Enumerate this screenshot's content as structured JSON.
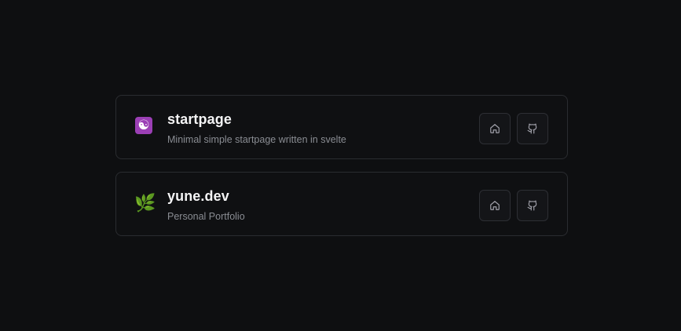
{
  "projects": [
    {
      "emoji": "☯",
      "title": "startpage",
      "description": "Minimal simple startpage written in svelte",
      "home_icon": "home-icon",
      "github_icon": "github-icon"
    },
    {
      "emoji": "🌿",
      "title": "yune.dev",
      "description": "Personal Portfolio",
      "home_icon": "home-icon",
      "github_icon": "github-icon"
    }
  ],
  "colors": {
    "background": "#0e0f11",
    "card_border": "#2a2c30",
    "title": "#f4f4f5",
    "description": "#8a8d93",
    "icon_stroke": "#a1a1aa",
    "yinyang_bg": "#9b3fb5"
  }
}
